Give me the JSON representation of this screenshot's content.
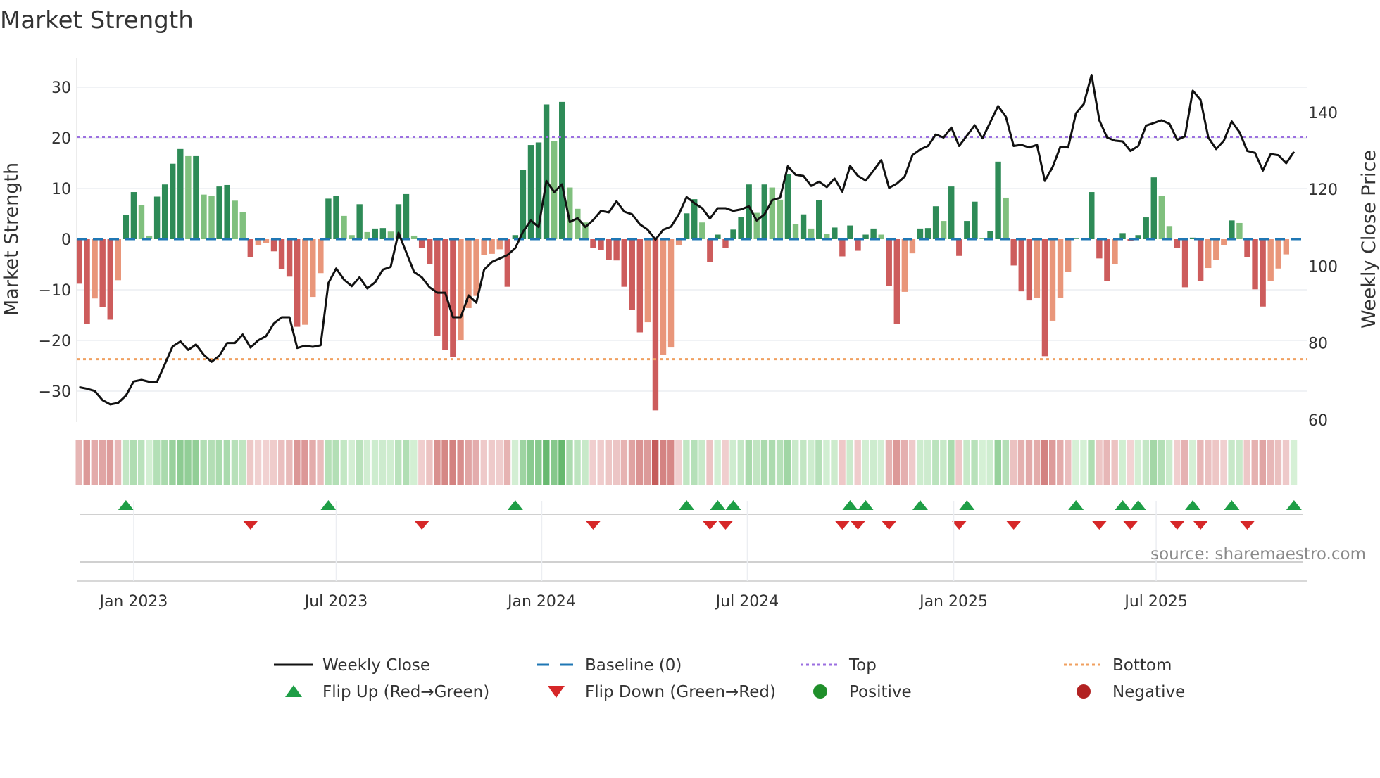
{
  "title": "Market Strength",
  "source": "source: sharemaestro.com",
  "chart_data": {
    "type": "bar",
    "title": "Market Strength",
    "ylabel_left": "Market Strength",
    "ylabel_right": "Weekly Close Price",
    "ylim_left": [
      -36,
      37
    ],
    "ylim_right": [
      58,
      152
    ],
    "yticks_left": [
      30,
      20,
      10,
      0,
      -10,
      -20,
      -30
    ],
    "yticks_right": [
      140,
      120,
      100,
      80,
      60
    ],
    "grid": true,
    "top_level": 20.2,
    "bottom_level": -23.7,
    "baseline": 0,
    "x_ticks": [
      {
        "label": "Jan 2023",
        "week": 7
      },
      {
        "label": "Jul 2023",
        "week": 33
      },
      {
        "label": "Jan 2024",
        "week": 59.4
      },
      {
        "label": "Jul 2024",
        "week": 85.8
      },
      {
        "label": "Jan 2025",
        "week": 112.3
      },
      {
        "label": "Jul 2025",
        "week": 138.3
      }
    ],
    "strength": [
      -8.8,
      -16.7,
      -11.7,
      -13.4,
      -15.9,
      -8.1,
      4.8,
      9.3,
      6.8,
      0.7,
      8.4,
      10.8,
      14.9,
      17.8,
      16.4,
      16.4,
      8.8,
      8.6,
      10.4,
      10.7,
      7.6,
      5.4,
      -3.5,
      -1.2,
      -0.8,
      -2.4,
      -5.9,
      -7.4,
      -17.3,
      -16.9,
      -11.4,
      -6.7,
      8.0,
      8.5,
      4.6,
      0.8,
      6.9,
      1.4,
      2.1,
      2.2,
      1.5,
      6.9,
      8.9,
      0.7,
      -1.7,
      -4.9,
      -19.1,
      -21.9,
      -23.3,
      -19.9,
      -13.6,
      -11.2,
      -3.1,
      -2.9,
      -2.0,
      -9.4,
      0.8,
      13.7,
      18.6,
      19.1,
      26.6,
      19.4,
      27.1,
      10.2,
      6.0,
      3.3,
      -1.7,
      -2.2,
      -4.1,
      -4.2,
      -9.4,
      -13.9,
      -18.4,
      -16.4,
      -33.8,
      -22.9,
      -21.4,
      -1.2,
      5.1,
      7.9,
      3.3,
      -4.5,
      0.9,
      -1.8,
      1.9,
      4.4,
      10.8,
      5.2,
      10.8,
      10.2,
      7.8,
      12.8,
      3.0,
      4.9,
      2.1,
      7.7,
      1.1,
      2.3,
      -3.4,
      2.7,
      -2.3,
      0.9,
      2.1,
      0.9,
      -9.2,
      -16.8,
      -10.4,
      -2.8,
      2.1,
      2.2,
      6.5,
      3.6,
      10.4,
      -3.3,
      3.6,
      7.4,
      0.2,
      1.6,
      15.3,
      8.2,
      -5.2,
      -10.3,
      -12.1,
      -11.6,
      -23.1,
      -16.1,
      -11.6,
      -6.4,
      0.1,
      0.2,
      9.3,
      -3.8,
      -8.2,
      -4.9,
      1.2,
      -0.3,
      0.8,
      4.3,
      12.2,
      8.5,
      2.6,
      -1.7,
      -9.5,
      0.3,
      -8.2,
      -5.7,
      -4.1,
      -1.2,
      3.7,
      3.2,
      -3.6,
      -9.9,
      -13.3,
      -8.2,
      -5.8,
      -3.0,
      0.1
    ],
    "weekly_close": [
      68.5,
      68.1,
      67.5,
      65.1,
      64.0,
      64.4,
      66.3,
      70.0,
      70.4,
      69.9,
      69.9,
      74.5,
      79.1,
      80.4,
      78.2,
      79.6,
      76.9,
      75.1,
      76.7,
      80.0,
      80.0,
      82.2,
      78.8,
      80.7,
      81.8,
      85.1,
      86.7,
      86.7,
      78.7,
      79.3,
      79.0,
      79.4,
      95.6,
      99.4,
      96.5,
      94.8,
      97.1,
      94.2,
      95.8,
      99.1,
      99.8,
      108.7,
      103.6,
      98.5,
      97.1,
      94.5,
      93.1,
      93.1,
      86.7,
      86.7,
      92.4,
      90.5,
      99.1,
      101.1,
      102.0,
      102.9,
      104.7,
      109.0,
      111.9,
      110.2,
      122.2,
      119.3,
      121.3,
      111.5,
      112.5,
      110.2,
      112.0,
      114.4,
      114.0,
      116.9,
      114.2,
      113.5,
      110.9,
      109.5,
      106.9,
      109.5,
      110.3,
      113.5,
      118.0,
      116.4,
      115.1,
      112.4,
      115.1,
      115.1,
      114.4,
      114.8,
      115.6,
      111.9,
      113.5,
      117.2,
      117.8,
      126.0,
      123.8,
      123.5,
      120.9,
      122.0,
      120.6,
      122.8,
      119.4,
      126.1,
      123.5,
      122.3,
      124.9,
      127.6,
      120.4,
      121.5,
      123.3,
      128.9,
      130.4,
      131.3,
      134.3,
      133.5,
      136.1,
      131.3,
      134.0,
      136.7,
      133.3,
      137.5,
      141.7,
      138.9,
      131.3,
      131.6,
      130.9,
      131.6,
      122.2,
      125.8,
      131.1,
      130.9,
      139.8,
      142.2,
      149.8,
      138.0,
      133.5,
      132.7,
      132.5,
      130.0,
      131.3,
      136.6,
      137.3,
      138.0,
      137.1,
      132.9,
      133.8,
      145.7,
      143.3,
      133.5,
      130.5,
      132.7,
      137.7,
      134.9,
      130.0,
      129.5,
      124.9,
      129.2,
      128.9,
      126.8,
      129.8
    ],
    "legend": {
      "placement": "bottom",
      "items": [
        {
          "label": "Weekly Close",
          "kind": "line",
          "color": "#111111"
        },
        {
          "label": "Baseline (0)",
          "kind": "dash",
          "color": "#1f77b4"
        },
        {
          "label": "Top",
          "kind": "dot",
          "color": "#9b6fe0"
        },
        {
          "label": "Bottom",
          "kind": "dot",
          "color": "#f0a060"
        },
        {
          "label": "Flip Up (Red→Green)",
          "kind": "tri-up",
          "color": "#1e9e46"
        },
        {
          "label": "Flip Down (Green→Red)",
          "kind": "tri-down",
          "color": "#d62728"
        },
        {
          "label": "Positive",
          "kind": "circle",
          "color": "#1f8f2a"
        },
        {
          "label": "Negative",
          "kind": "circle",
          "color": "#b22222"
        }
      ]
    }
  },
  "colors": {
    "pos_strong": "#2e8b57",
    "pos_weak": "#80c07e",
    "neg_strong": "#cd5c5c",
    "neg_weak": "#e9967a",
    "price": "#111111"
  }
}
